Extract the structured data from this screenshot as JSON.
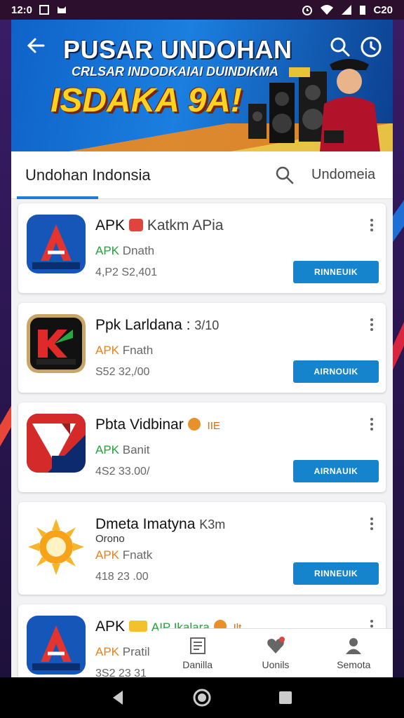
{
  "status_bar": {
    "time": "12:0",
    "right_text": "C20"
  },
  "banner": {
    "title": "PUSAR UNDOHAN",
    "subtitle": "CRLSAR INDODKAIAI DUINDIKMA",
    "big_text": "ISDAKA 9A!"
  },
  "tabs": {
    "active": "Undohan Indonsia",
    "right": "Undomeia"
  },
  "apps": [
    {
      "name": "APK",
      "badge": "red",
      "extra": "Katkm APia",
      "tag_prefix": "APK",
      "tag_rest": "Dnath",
      "tag_color": "green",
      "meta": "4,P2 S2,401",
      "button": "RINNEUIK",
      "icon": "a-letter-icon"
    },
    {
      "name": "Ppk Larldana :",
      "extra": "3/10",
      "tag_prefix": "APK",
      "tag_rest": "Fnath",
      "tag_color": "orange",
      "meta": "S52 32,/00",
      "button": "AIRNOUIK",
      "icon": "k-letter-icon"
    },
    {
      "name": "Pbta Vidbinar",
      "badge": "verified",
      "extra": "IIE",
      "tag_prefix": "APK",
      "tag_rest": "Banit",
      "tag_color": "green",
      "meta": "4S2 33.00/",
      "button": "AIRNAUIK",
      "icon": "apk-fold-icon"
    },
    {
      "name": "Dmeta Imatyna",
      "extra": "K3m",
      "sub": "Orono",
      "tag_prefix": "APK",
      "tag_rest": "Fnatk",
      "tag_color": "orange",
      "meta": "418 23 .00",
      "button": "RINNEUIK",
      "icon": "sun-icon"
    },
    {
      "name": "APK",
      "badge": "yellow",
      "extra": "AIP Ikalara",
      "extra2": "Ilt",
      "tag_prefix": "APK",
      "tag_rest": "Pratil",
      "tag_color": "orange",
      "meta": "3S2 23 31",
      "button": "",
      "icon": "a-letter-icon"
    }
  ],
  "bottom_nav": [
    {
      "label": "Danilla",
      "icon": "document-icon"
    },
    {
      "label": "Uonils",
      "icon": "heart-icon"
    },
    {
      "label": "Semota",
      "icon": "person-icon"
    }
  ]
}
